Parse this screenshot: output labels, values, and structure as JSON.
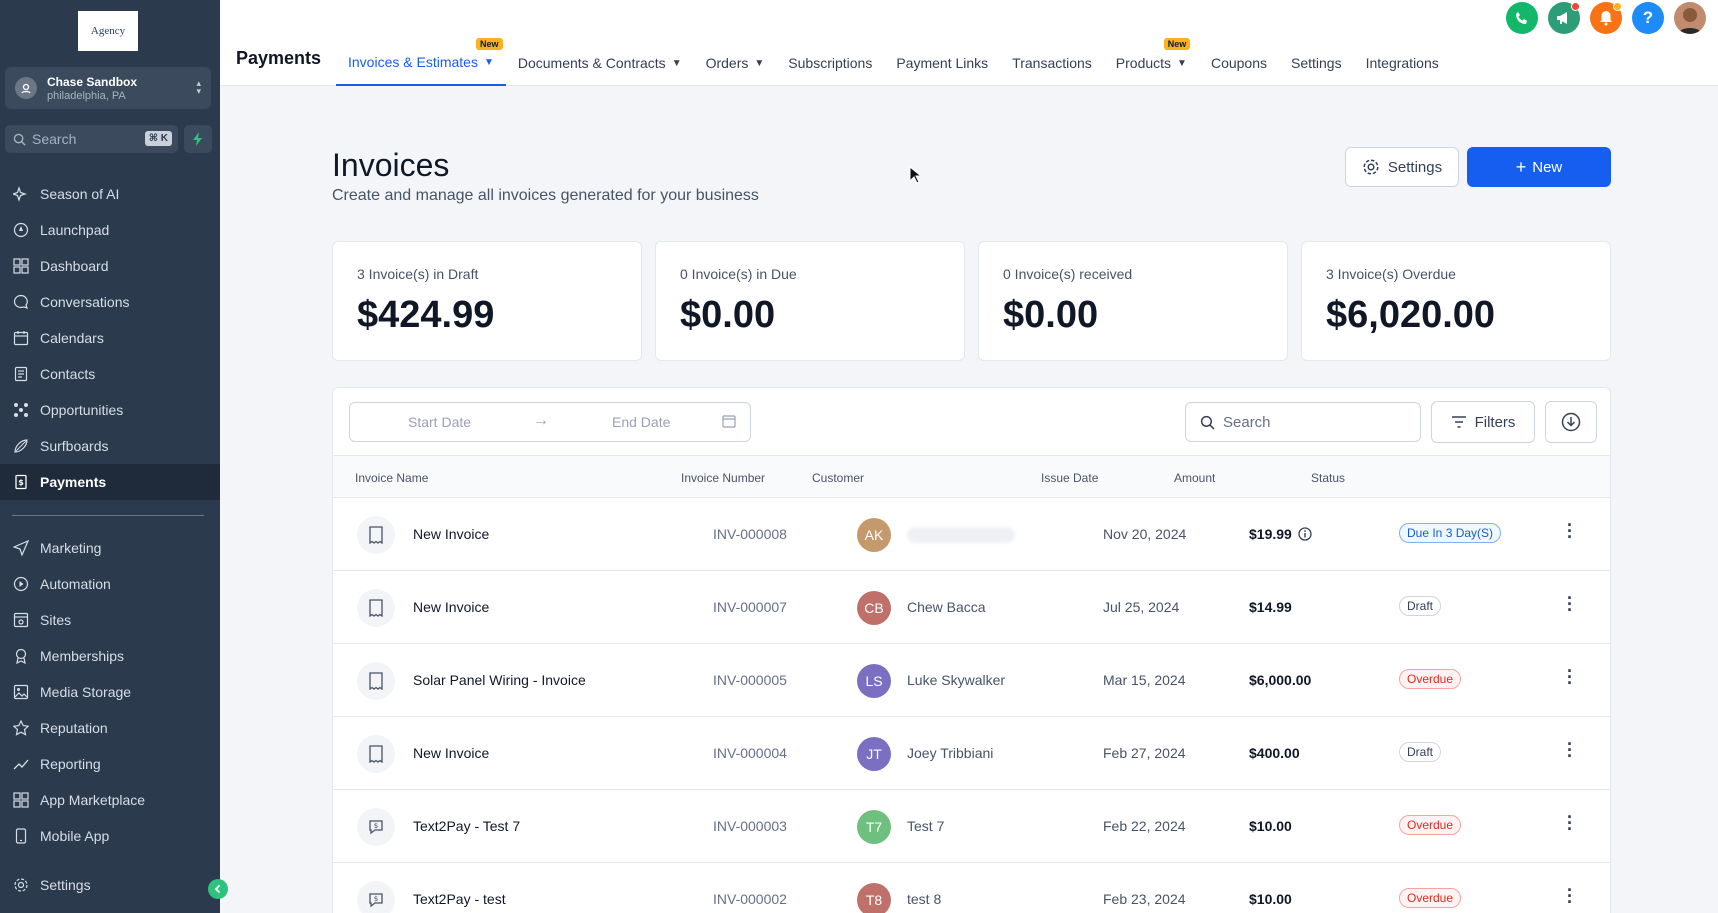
{
  "sidebar": {
    "logo_text": "Agency",
    "account": {
      "name": "Chase Sandbox",
      "location": "philadelphia, PA"
    },
    "search": {
      "placeholder": "Search",
      "shortcut": "⌘ K"
    },
    "items": [
      {
        "label": "Season of AI",
        "icon": "sparkle-icon"
      },
      {
        "label": "Launchpad",
        "icon": "rocket-icon"
      },
      {
        "label": "Dashboard",
        "icon": "grid-icon"
      },
      {
        "label": "Conversations",
        "icon": "chat-icon"
      },
      {
        "label": "Calendars",
        "icon": "calendar-icon"
      },
      {
        "label": "Contacts",
        "icon": "contacts-icon"
      },
      {
        "label": "Opportunities",
        "icon": "opportunities-icon"
      },
      {
        "label": "Surfboards",
        "icon": "surfboard-icon"
      },
      {
        "label": "Payments",
        "icon": "payments-icon",
        "active": true
      }
    ],
    "items2": [
      {
        "label": "Marketing",
        "icon": "send-icon"
      },
      {
        "label": "Automation",
        "icon": "automation-icon"
      },
      {
        "label": "Sites",
        "icon": "sites-icon"
      },
      {
        "label": "Memberships",
        "icon": "badge-icon"
      },
      {
        "label": "Media Storage",
        "icon": "image-icon"
      },
      {
        "label": "Reputation",
        "icon": "star-icon"
      },
      {
        "label": "Reporting",
        "icon": "chart-line-icon"
      },
      {
        "label": "App Marketplace",
        "icon": "apps-icon"
      },
      {
        "label": "Mobile App",
        "icon": "mobile-icon"
      }
    ],
    "settings_label": "Settings"
  },
  "header": {
    "title": "Payments",
    "new_badge": "New",
    "tabs": [
      {
        "label": "Invoices & Estimates",
        "active": true,
        "dropdown": true,
        "new": true
      },
      {
        "label": "Documents & Contracts",
        "dropdown": true
      },
      {
        "label": "Orders",
        "dropdown": true
      },
      {
        "label": "Subscriptions"
      },
      {
        "label": "Payment Links"
      },
      {
        "label": "Transactions"
      },
      {
        "label": "Products",
        "dropdown": true,
        "new": true
      },
      {
        "label": "Coupons"
      },
      {
        "label": "Settings"
      },
      {
        "label": "Integrations"
      }
    ]
  },
  "main": {
    "title": "Invoices",
    "subtitle": "Create and manage all invoices generated for your business",
    "settings_button": "Settings",
    "new_button": "New",
    "stats": [
      {
        "label": "3 Invoice(s) in Draft",
        "value": "$424.99"
      },
      {
        "label": "0 Invoice(s) in Due",
        "value": "$0.00"
      },
      {
        "label": "0 Invoice(s) received",
        "value": "$0.00"
      },
      {
        "label": "3 Invoice(s) Overdue",
        "value": "$6,020.00"
      }
    ],
    "toolbar": {
      "start_date": "Start Date",
      "end_date": "End Date",
      "search_placeholder": "Search",
      "filters_label": "Filters"
    },
    "columns": [
      "Invoice Name",
      "Invoice Number",
      "Customer",
      "Issue Date",
      "Amount",
      "Status"
    ],
    "rows": [
      {
        "name": "New Invoice",
        "number": "INV-000008",
        "initials": "AK",
        "customer": "",
        "issue_date": "Nov 20, 2024",
        "amount": "$19.99",
        "status": "Due In 3 Day(S)"
      },
      {
        "name": "New Invoice",
        "number": "INV-000007",
        "initials": "CB",
        "customer": "Chew Bacca",
        "issue_date": "Jul 25, 2024",
        "amount": "$14.99",
        "status": "Draft"
      },
      {
        "name": "Solar Panel Wiring - Invoice",
        "number": "INV-000005",
        "initials": "LS",
        "customer": "Luke Skywalker",
        "issue_date": "Mar 15, 2024",
        "amount": "$6,000.00",
        "status": "Overdue"
      },
      {
        "name": "New Invoice",
        "number": "INV-000004",
        "initials": "JT",
        "customer": "Joey Tribbiani",
        "issue_date": "Feb 27, 2024",
        "amount": "$400.00",
        "status": "Draft"
      },
      {
        "name": "Text2Pay - Test 7",
        "number": "INV-000003",
        "initials": "T7",
        "customer": "Test 7",
        "issue_date": "Feb 22, 2024",
        "amount": "$10.00",
        "status": "Overdue"
      },
      {
        "name": "Text2Pay - test",
        "number": "INV-000002",
        "initials": "T8",
        "customer": "test 8",
        "issue_date": "Feb 23, 2024",
        "amount": "$10.00",
        "status": "Overdue"
      }
    ]
  },
  "colors": {
    "sidebar_bg": "#2b3a4d",
    "primary": "#155eef",
    "overdue": "#d92d20",
    "avatar_ak": "#c49a6c",
    "avatar_cb": "#c0706a",
    "avatar_ls": "#7b6fc2",
    "avatar_jt": "#7b6fc2",
    "avatar_t7": "#6fbf7f",
    "avatar_t8": "#c0706a"
  }
}
